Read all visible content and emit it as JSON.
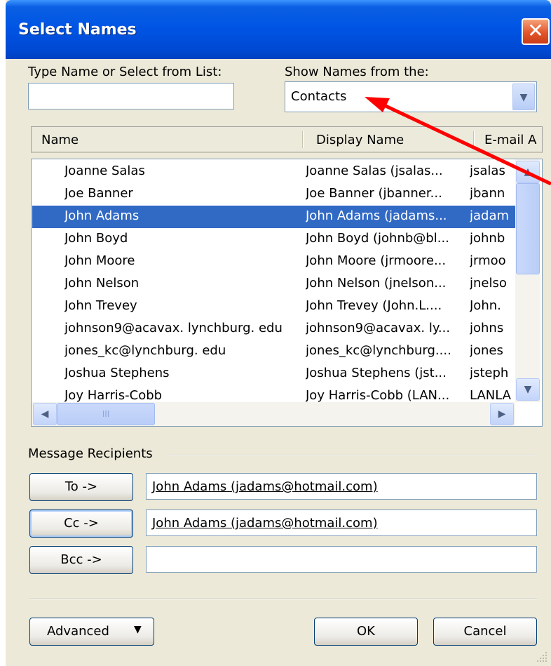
{
  "window": {
    "title": "Select Names",
    "close_glyph": "✕"
  },
  "search": {
    "label": "Type Name or Select from List:",
    "value": ""
  },
  "address_book": {
    "label": "Show Names from the:",
    "selected": "Contacts"
  },
  "list": {
    "columns": [
      "Name",
      "Display Name",
      "E-mail A"
    ],
    "rows": [
      {
        "name": "Joanne Salas",
        "display": "Joanne Salas (jsalas...",
        "email": "jsalas"
      },
      {
        "name": "Joe Banner",
        "display": "Joe Banner (jbanner...",
        "email": "jbann"
      },
      {
        "name": "John Adams",
        "display": "John Adams (jadams...",
        "email": "jadam"
      },
      {
        "name": "John Boyd",
        "display": "John Boyd (johnb@bl...",
        "email": "johnb"
      },
      {
        "name": "John Moore",
        "display": "John Moore (jrmoore...",
        "email": "jrmoo"
      },
      {
        "name": "John Nelson",
        "display": "John Nelson (jnelson...",
        "email": "jnelso"
      },
      {
        "name": "John Trevey",
        "display": "John Trevey (John.L....",
        "email": "John."
      },
      {
        "name": "johnson9@acavax. lynchburg. edu",
        "display": "johnson9@acavax. ly...",
        "email": "johns"
      },
      {
        "name": "jones_kc@lynchburg. edu",
        "display": "jones_kc@lynchburg....",
        "email": "jones"
      },
      {
        "name": "Joshua Stephens",
        "display": "Joshua Stephens (jst...",
        "email": "jsteph"
      },
      {
        "name": "Joy Harris-Cobb",
        "display": "Joy Harris-Cobb (LAN...",
        "email": "LANLA"
      }
    ],
    "selected_index": 2
  },
  "recipients": {
    "group_label": "Message Recipients",
    "to": {
      "button": "To ->",
      "value": "John Adams (jadams@hotmail.com)"
    },
    "cc": {
      "button": "Cc ->",
      "value": "John Adams (jadams@hotmail.com)"
    },
    "bcc": {
      "button": "Bcc ->",
      "value": ""
    }
  },
  "footer": {
    "advanced": "Advanced",
    "ok": "OK",
    "cancel": "Cancel"
  },
  "icons": {
    "dropdown": "chevron-down-icon",
    "scroll_up": "scroll-up-icon",
    "scroll_down": "scroll-down-icon",
    "scroll_left": "scroll-left-icon",
    "scroll_right": "scroll-right-icon",
    "annotation": "red-arrow"
  },
  "colors": {
    "title_bar": "#0055e5",
    "selection": "#316ac5",
    "annotation_arrow": "#ff0000",
    "dialog_bg": "#ece9d8"
  }
}
